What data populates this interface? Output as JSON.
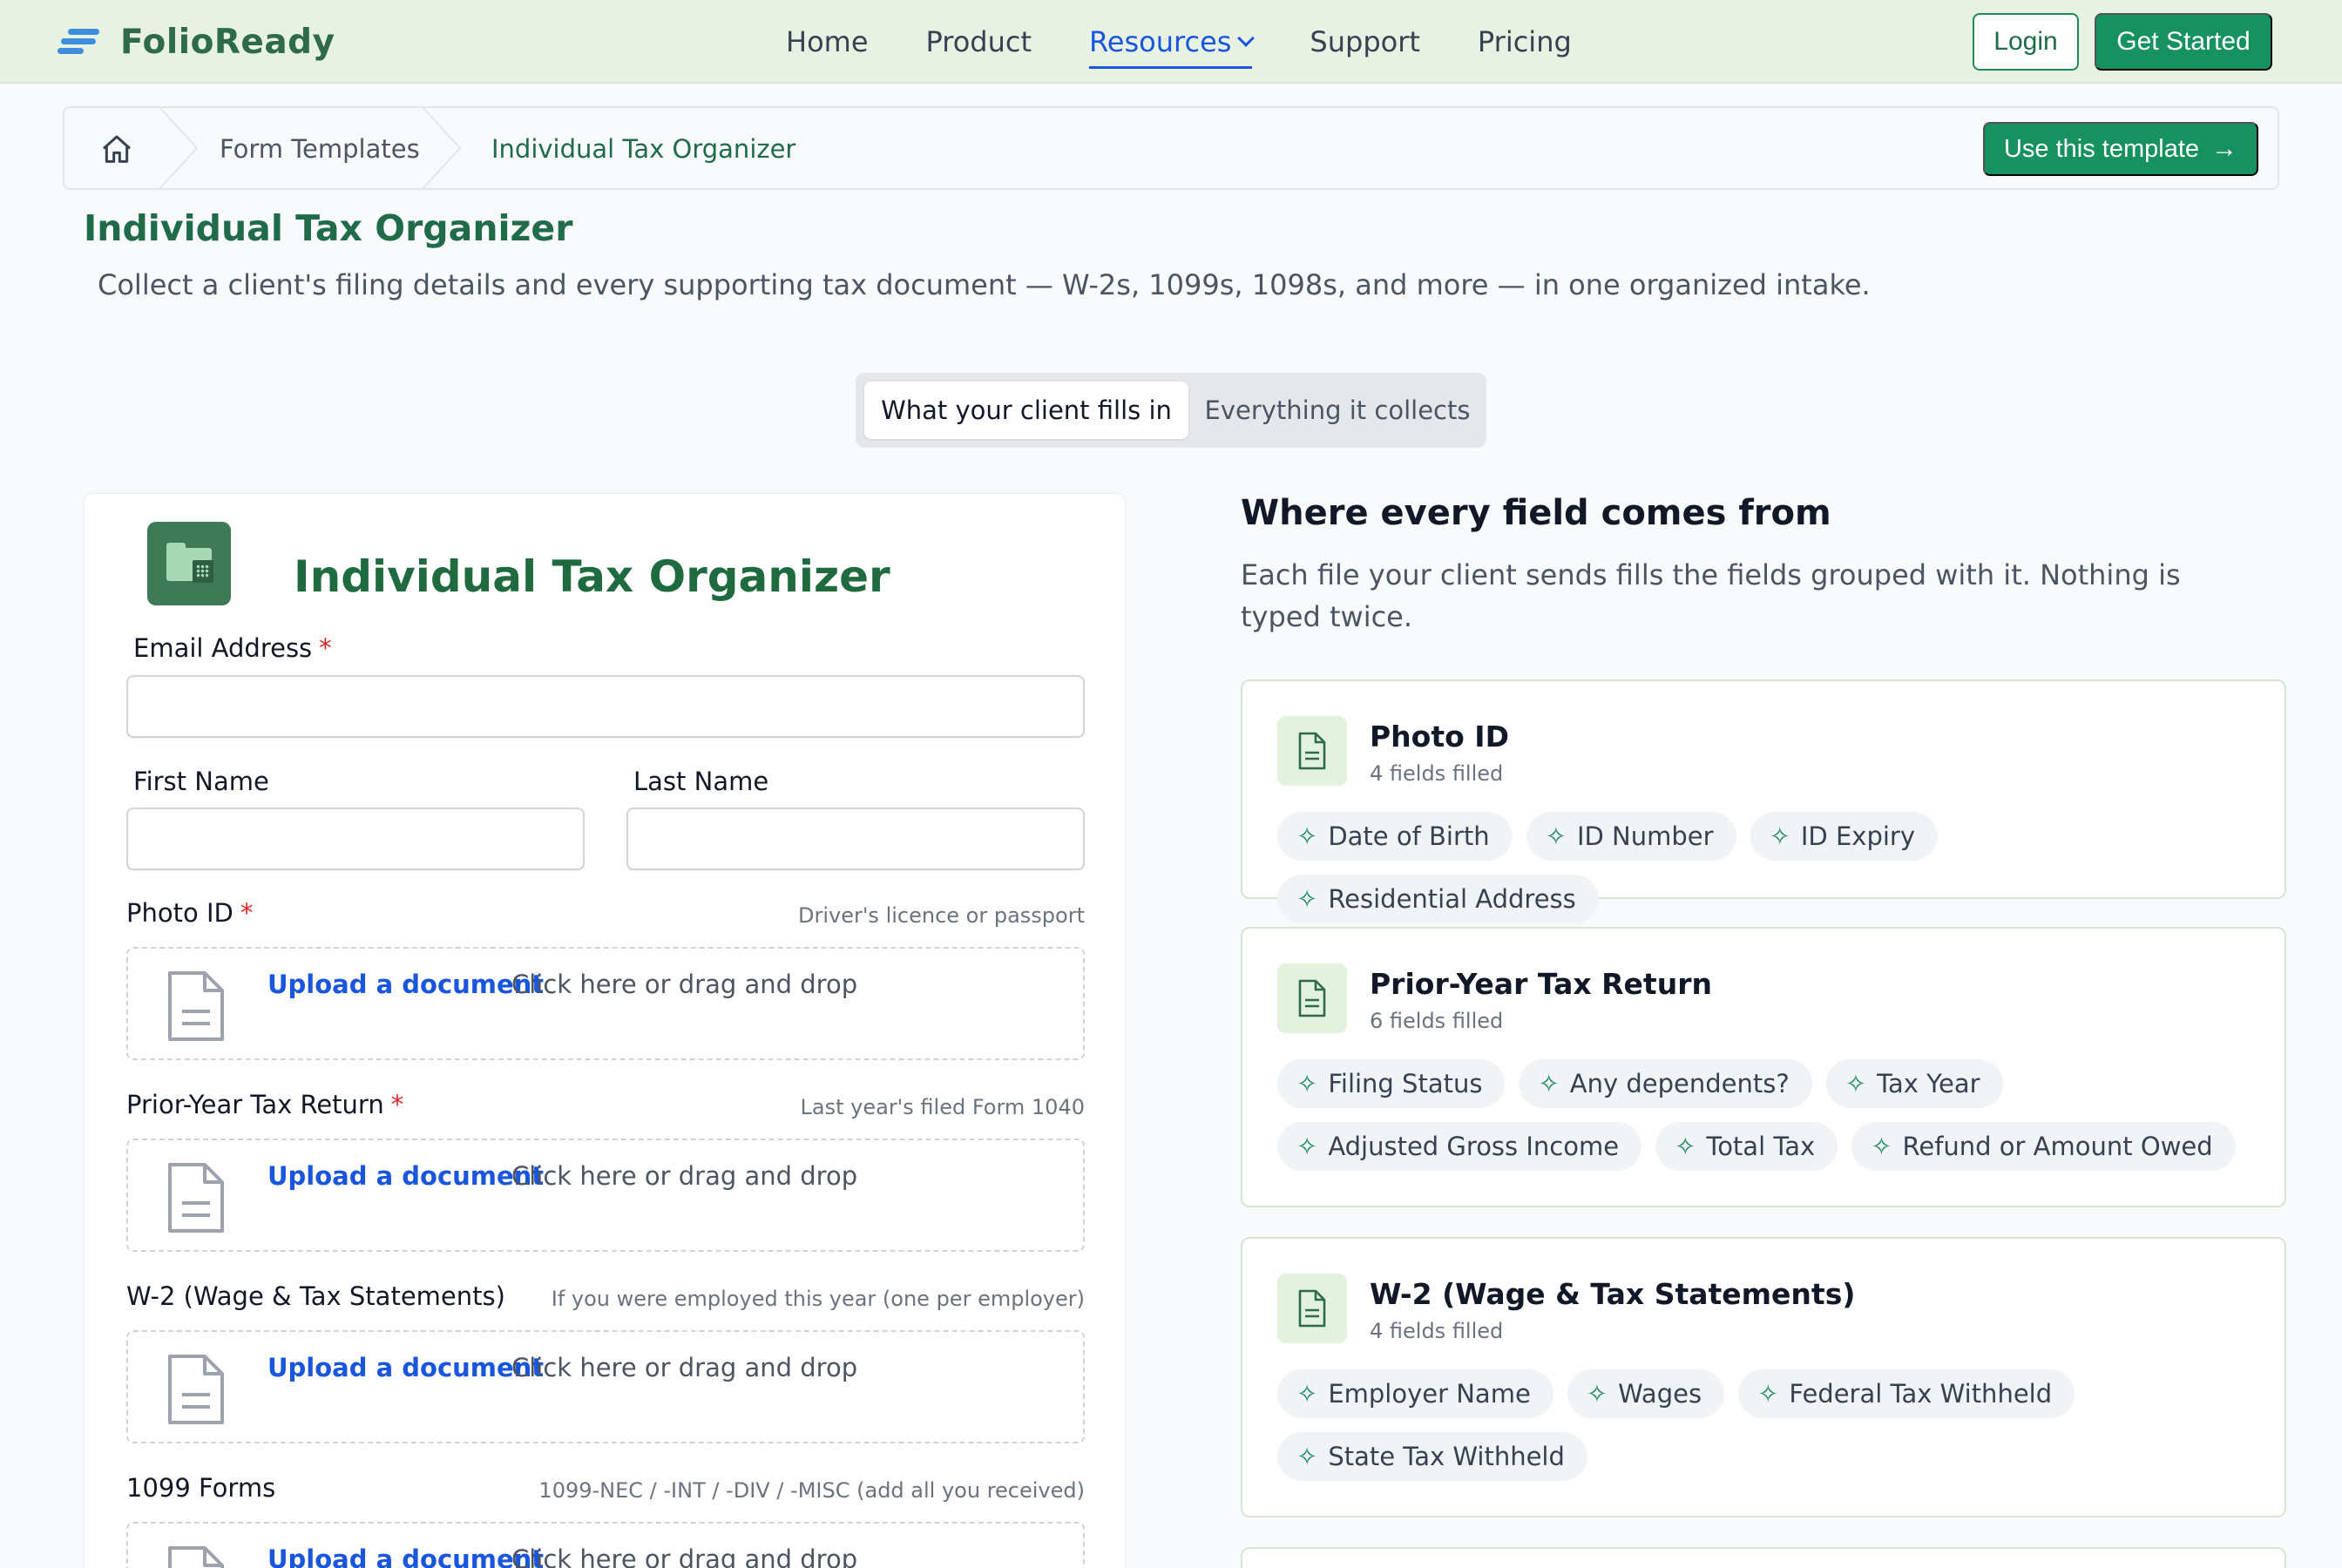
{
  "nav": {
    "brand": "FolioReady",
    "items": [
      {
        "label": "Home"
      },
      {
        "label": "Product"
      },
      {
        "label": "Resources",
        "active": true
      },
      {
        "label": "Support"
      },
      {
        "label": "Pricing"
      }
    ],
    "login": "Login",
    "get_started": "Get Started"
  },
  "breadcrumb": {
    "items": [
      "Form Templates",
      "Individual Tax Organizer"
    ],
    "use_template": "Use this template"
  },
  "page": {
    "title": "Individual Tax Organizer",
    "description": "Collect a client's filing details and every supporting tax document — W-2s, 1099s, 1098s, and more — in one organized intake."
  },
  "toggle": {
    "option_a": "What your client fills in",
    "option_b": "Everything it collects",
    "selected": "option_a"
  },
  "form": {
    "heading": "Individual Tax Organizer",
    "email_label": "Email Address",
    "first_name_label": "First Name",
    "last_name_label": "Last Name",
    "upload_link": "Upload a document",
    "upload_text": "Click here or drag and drop",
    "uploads": [
      {
        "label": "Photo ID",
        "required": true,
        "hint": "Driver's licence or passport"
      },
      {
        "label": "Prior-Year Tax Return",
        "required": true,
        "hint": "Last year's filed Form 1040"
      },
      {
        "label": "W-2 (Wage & Tax Statements)",
        "required": false,
        "hint": "If you were employed this year (one per employer)"
      },
      {
        "label": "1099 Forms",
        "required": false,
        "hint": "1099-NEC / -INT / -DIV / -MISC (add all you received)"
      }
    ]
  },
  "sources": {
    "title": "Where every field comes from",
    "description": "Each file your client sends fills the fields grouped with it. Nothing is typed twice.",
    "cards": [
      {
        "name": "Photo ID",
        "count": "4 fields filled",
        "fields": [
          "Date of Birth",
          "ID Number",
          "ID Expiry",
          "Residential Address"
        ]
      },
      {
        "name": "Prior-Year Tax Return",
        "count": "6 fields filled",
        "fields": [
          "Filing Status",
          "Any dependents?",
          "Tax Year",
          "Adjusted Gross Income",
          "Total Tax",
          "Refund or Amount Owed"
        ]
      },
      {
        "name": "W-2 (Wage & Tax Statements)",
        "count": "4 fields filled",
        "fields": [
          "Employer Name",
          "Wages",
          "Federal Tax Withheld",
          "State Tax Withheld"
        ]
      }
    ]
  },
  "colors": {
    "brand_green": "#17915f",
    "nav_bg": "#e8f2e2",
    "link_blue": "#1a56db",
    "required_red": "#dc2626"
  }
}
